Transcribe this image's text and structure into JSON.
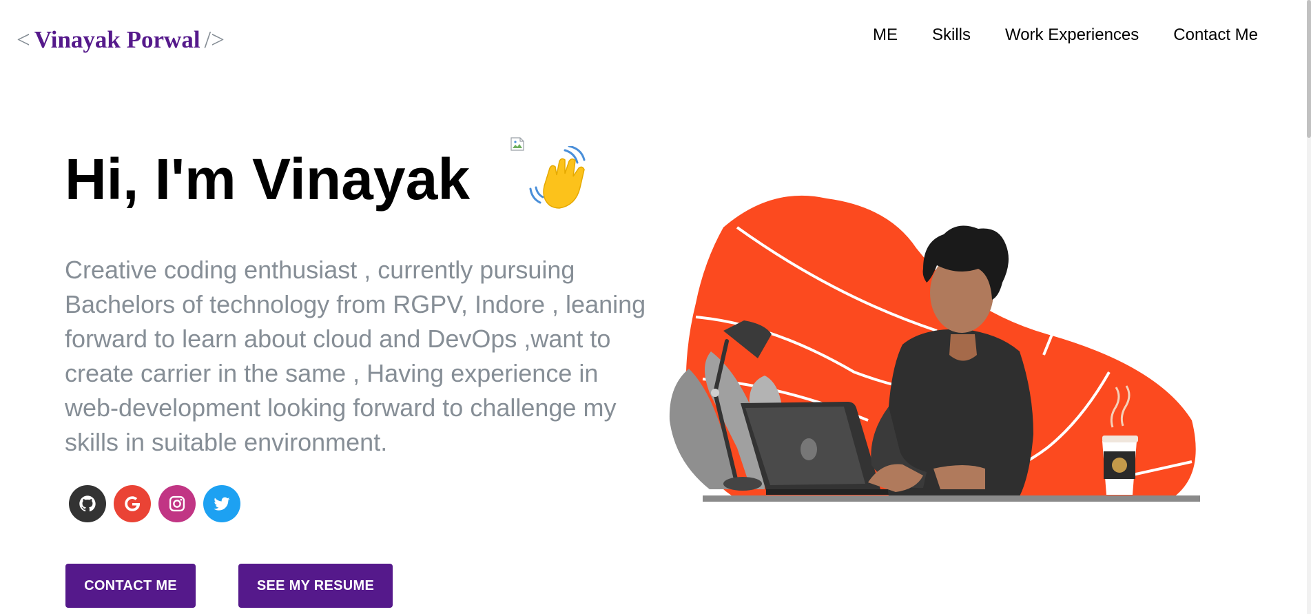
{
  "header": {
    "logo_open": "<",
    "logo_name": "Vinayak Porwal",
    "logo_close": "/>",
    "nav": [
      "ME",
      "Skills",
      "Work Experiences",
      "Contact Me"
    ]
  },
  "hero": {
    "greeting": "Hi, I'm Vinayak",
    "greeting_emoji": "waving-hand",
    "subtitle": "Creative coding enthusiast , currently pursuing Bachelors of technology from RGPV, Indore , leaning forward to learn about cloud and DevOps ,want to create carrier in the same , Having experience in web-development looking forward to challenge my skills in suitable environment."
  },
  "social": [
    {
      "icon": "github-icon",
      "color": "#333333"
    },
    {
      "icon": "google-icon",
      "color": "#ea4335"
    },
    {
      "icon": "instagram-icon",
      "color": "#c13584"
    },
    {
      "icon": "twitter-icon",
      "color": "#1da1f2"
    }
  ],
  "buttons": {
    "contact": "CONTACT ME",
    "resume": "SEE MY RESUME"
  },
  "colors": {
    "accent": "#55198b",
    "subtitle": "#868e96",
    "illustration_blob": "#fc4a1f"
  }
}
